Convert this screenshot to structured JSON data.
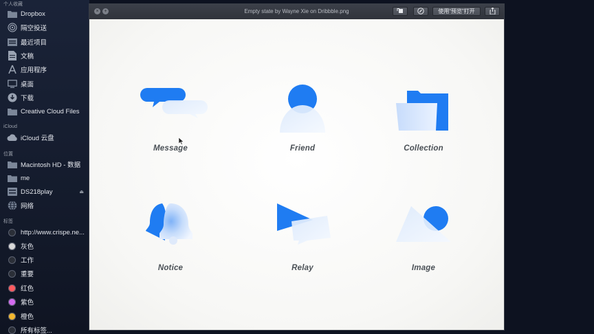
{
  "sidebar": {
    "favorites_header": "个人收藏",
    "favorites": [
      {
        "label": "Dropbox",
        "icon": "folder-icon"
      },
      {
        "label": "隔空投送",
        "icon": "airdrop-icon"
      },
      {
        "label": "最近项目",
        "icon": "recents-icon"
      },
      {
        "label": "文稿",
        "icon": "document-icon"
      },
      {
        "label": "应用程序",
        "icon": "applications-icon"
      },
      {
        "label": "桌面",
        "icon": "desktop-icon"
      },
      {
        "label": "下载",
        "icon": "download-icon"
      },
      {
        "label": "Creative Cloud Files",
        "icon": "folder-icon"
      }
    ],
    "icloud_header": "iCloud",
    "icloud": [
      {
        "label": "iCloud 云盘",
        "icon": "cloud-icon"
      }
    ],
    "locations_header": "位置",
    "locations": [
      {
        "label": "Macintosh HD - 数据",
        "icon": "folder-icon"
      },
      {
        "label": "me",
        "icon": "folder-icon"
      },
      {
        "label": "DS218play",
        "icon": "server-icon",
        "eject": "⏏"
      },
      {
        "label": "网络",
        "icon": "network-icon"
      }
    ],
    "tags_header": "标签",
    "tags": [
      {
        "label": "http://www.crispe.ne...",
        "color": "#2b2f38"
      },
      {
        "label": "灰色",
        "color": "#d9d9d9"
      },
      {
        "label": "工作",
        "color": "#2b2f38"
      },
      {
        "label": "重要",
        "color": "#2b2f38"
      },
      {
        "label": "红色",
        "color": "#ff5a5f"
      },
      {
        "label": "紫色",
        "color": "#d46bf0"
      },
      {
        "label": "橙色",
        "color": "#f5b82e"
      },
      {
        "label": "所有标签...",
        "color": "#2b2f38"
      }
    ]
  },
  "window": {
    "title": "Empty state by Wayne Xie on Dribbble.png",
    "open_with_label": "使用“预览”打开",
    "rotate_icon": "rotate-icon",
    "markup_icon": "markup-icon",
    "share_icon": "share-icon"
  },
  "illustrations": {
    "accent": "#1f7cf2",
    "items": [
      {
        "label": "Message",
        "icon": "message-icon"
      },
      {
        "label": "Friend",
        "icon": "friend-icon"
      },
      {
        "label": "Collection",
        "icon": "collection-icon"
      },
      {
        "label": "Notice",
        "icon": "notice-icon"
      },
      {
        "label": "Relay",
        "icon": "relay-icon"
      },
      {
        "label": "Image",
        "icon": "image-icon"
      }
    ]
  }
}
